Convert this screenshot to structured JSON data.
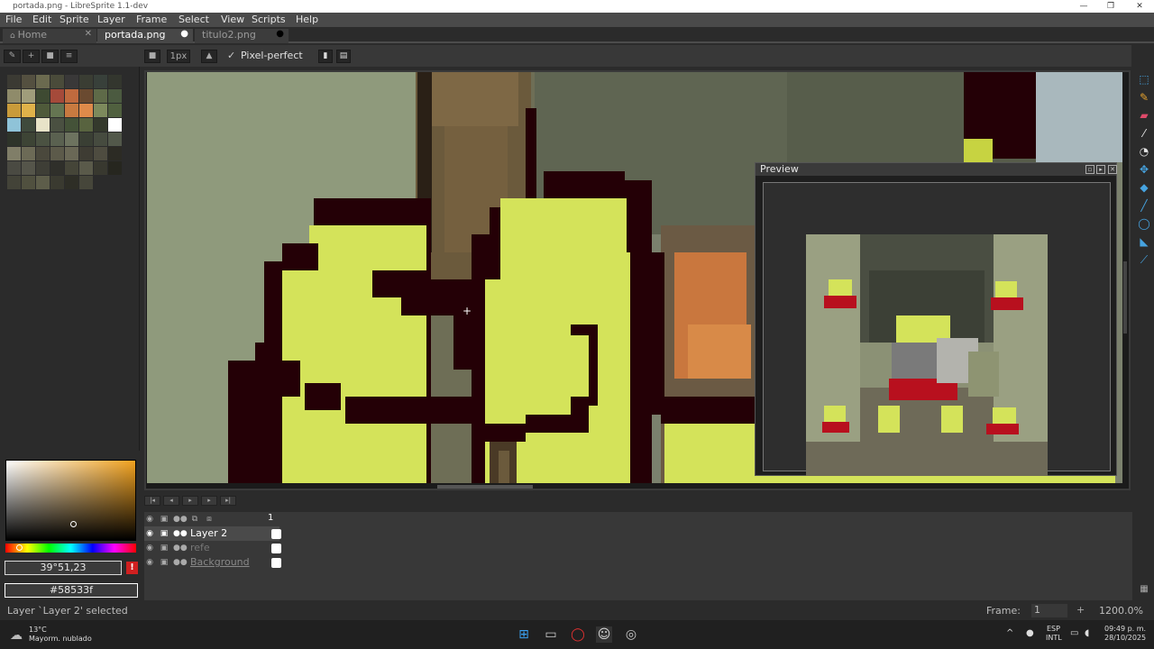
{
  "window": {
    "title": "portada.png - LibreSprite 1.1-dev",
    "minimize": "—",
    "maximize": "❐",
    "close": "✕"
  },
  "menu": [
    "File",
    "Edit",
    "Sprite",
    "Layer",
    "Frame",
    "Select",
    "View",
    "Scripts",
    "Help"
  ],
  "tabs": [
    {
      "label": "Home",
      "close": "✕"
    },
    {
      "label": "portada.png",
      "close": "●"
    },
    {
      "label": "titulo2.png",
      "close": "●"
    }
  ],
  "toolbar": {
    "brush_size": "1px",
    "pixel_perfect_label": "Pixel-perfect"
  },
  "color": {
    "hsv_value": "39°51,23",
    "hex_value": "#58533f",
    "warning_icon": "!"
  },
  "preview": {
    "title": "Preview"
  },
  "layers": {
    "frame_number": "1",
    "items": [
      {
        "name": "Layer 2",
        "selected": true
      },
      {
        "name": "refe",
        "selected": false
      },
      {
        "name": "Background",
        "selected": false
      }
    ]
  },
  "status": {
    "message": "Layer `Layer 2' selected",
    "frame_label": "Frame:",
    "frame_value": "1",
    "zoom": "1200.0%"
  },
  "taskbar": {
    "weather_temp": "13°C",
    "weather_desc": "Mayorm. nublado",
    "lang": "ESP",
    "layout": "INTL",
    "time": "09:49 p. m.",
    "date": "28/10/2025"
  },
  "colors": {
    "accent": "#46a3e0",
    "menubar_bg": "#4a4a4a",
    "panel_bg": "#2b2b2b",
    "frog_green": "#d4e35a",
    "outline": "#240006"
  }
}
